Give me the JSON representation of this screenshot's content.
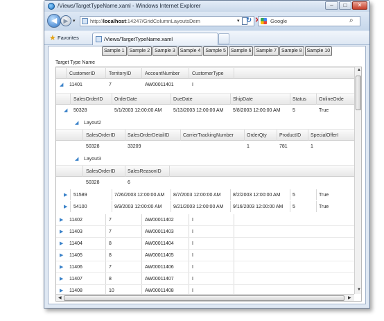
{
  "window": {
    "title": "/Views/TargetTypeName.xaml - Windows Internet Explorer",
    "min_label": "–",
    "max_label": "□",
    "close_label": "✕"
  },
  "nav": {
    "url_prefix": "http://",
    "url_host": "localhost",
    "url_rest": ":14247/GridColumnLayoutsDem",
    "search_engine": "Google",
    "back_glyph": "◀",
    "fwd_glyph": "▶",
    "refresh_glyph": "↻",
    "stop_glyph": "✕",
    "search_glyph": "⌕",
    "dropdown_glyph": "▾"
  },
  "favbar": {
    "favorites_label": "Favorites",
    "tab_title": "/Views/TargetTypeName.xaml"
  },
  "samples": [
    "Sample 1",
    "Sample 2",
    "Sample 3",
    "Sample 4",
    "Sample 5",
    "Sample 6",
    "Sample 7",
    "Sample 8",
    "Sample 10"
  ],
  "grid": {
    "title": "Target Type Name",
    "columns": [
      "CustomerID",
      "TerritoryID",
      "AccountNumber",
      "CustomerType"
    ],
    "expand_glyph": "▶",
    "collapse_glyph": "◢",
    "rows_top": [
      {
        "id": "11401",
        "territory": "7",
        "account": "AW00011401",
        "type": "I"
      }
    ],
    "orders_columns": [
      "SalesOrderID",
      "OrderDate",
      "DueDate",
      "ShipDate",
      "Status",
      "OnlineOrde"
    ],
    "orders_expanded": {
      "id": "50328",
      "order": "5/1/2003 12:00:00 AM",
      "due": "5/13/2003 12:00:00 AM",
      "ship": "5/8/2003 12:00:00 AM",
      "status": "5",
      "online": "True"
    },
    "layout2": {
      "label": "Layout2",
      "columns": [
        "SalesOrderID",
        "SalesOrderDetailID",
        "CarrierTrackingNumber",
        "OrderQty",
        "ProductID",
        "SpecialOfferI"
      ],
      "row": {
        "order": "50328",
        "detail": "33209",
        "tracking": "",
        "qty": "1",
        "product": "781",
        "offer": "1"
      }
    },
    "layout3": {
      "label": "Layout3",
      "columns": [
        "SalesOrderID",
        "SalesReasonID"
      ],
      "row": {
        "order": "50328",
        "reason": "6"
      }
    },
    "orders_more": [
      {
        "id": "51589",
        "order": "7/26/2003 12:00:00 AM",
        "due": "8/7/2003 12:00:00 AM",
        "ship": "8/2/2003 12:00:00 AM",
        "status": "5",
        "online": "True"
      },
      {
        "id": "54100",
        "order": "9/9/2003 12:00:00 AM",
        "due": "9/21/2003 12:00:00 AM",
        "ship": "9/16/2003 12:00:00 AM",
        "status": "5",
        "online": "True"
      }
    ],
    "rows_bottom": [
      {
        "id": "11402",
        "territory": "7",
        "account": "AW00011402",
        "type": "I"
      },
      {
        "id": "11403",
        "territory": "7",
        "account": "AW00011403",
        "type": "I"
      },
      {
        "id": "11404",
        "territory": "8",
        "account": "AW00011404",
        "type": "I"
      },
      {
        "id": "11405",
        "territory": "8",
        "account": "AW00011405",
        "type": "I"
      },
      {
        "id": "11406",
        "territory": "7",
        "account": "AW00011406",
        "type": "I"
      },
      {
        "id": "11407",
        "territory": "8",
        "account": "AW00011407",
        "type": "I"
      },
      {
        "id": "11408",
        "territory": "10",
        "account": "AW00011408",
        "type": "I"
      }
    ]
  }
}
